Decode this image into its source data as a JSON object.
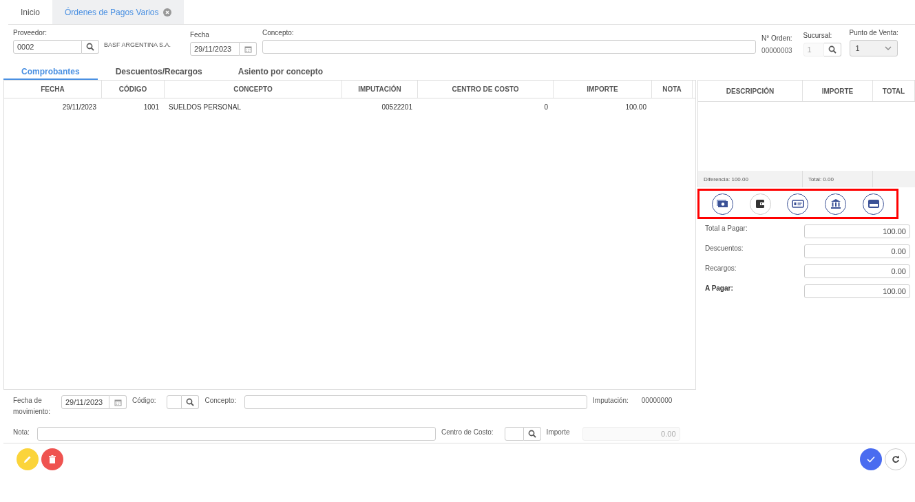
{
  "top_tabs": [
    {
      "label": "Inicio",
      "selected": false,
      "closable": false
    },
    {
      "label": "Órdenes de Pagos Varios",
      "selected": true,
      "closable": true
    }
  ],
  "header": {
    "proveedor": {
      "label": "Proveedor:",
      "value": "0002",
      "name": "BASF ARGENTINA S.A."
    },
    "fecha": {
      "label": "Fecha",
      "value": "29/11/2023"
    },
    "concepto": {
      "label": "Concepto:"
    },
    "orden": {
      "label": "N° Orden:",
      "value": "00000003"
    },
    "sucursal": {
      "label": "Sucursal:",
      "value": "1",
      "disabled": true
    },
    "punto_venta": {
      "label": "Punto de Venta:",
      "value": "1"
    }
  },
  "section_tabs": [
    {
      "label": "Comprobantes",
      "selected": true
    },
    {
      "label": "Descuentos/Recargos",
      "selected": false
    },
    {
      "label": "Asiento por concepto",
      "selected": false
    }
  ],
  "table": {
    "columns": [
      "FECHA",
      "CÓDIGO",
      "CONCEPTO",
      "IMPUTACIÓN",
      "CENTRO DE COSTO",
      "IMPORTE",
      "NOTA"
    ],
    "rows": [
      [
        "29/11/2023",
        "1001",
        "SUELDOS PERSONAL",
        "00522201",
        "0",
        "100.00",
        null
      ]
    ]
  },
  "payments": {
    "columns": [
      "DESCRIPCIÓN",
      "IMPORTE",
      "TOTAL"
    ],
    "diferencia": "Diferencia: 100.00",
    "total": "Total: 0.00"
  },
  "payment_methods": [
    {
      "kind": "cash"
    },
    {
      "kind": "wallet"
    },
    {
      "kind": "check"
    },
    {
      "kind": "bank"
    },
    {
      "kind": "card"
    }
  ],
  "totals": [
    {
      "label": "Total a Pagar:",
      "value": "100.00",
      "bold": false
    },
    {
      "label": "Descuentos:",
      "value": "0.00",
      "bold": false
    },
    {
      "label": "Recargos:",
      "value": "0.00",
      "bold": false
    },
    {
      "label": "A Pagar:",
      "value": "100.00",
      "bold": true
    }
  ],
  "movement": {
    "fecha_label": "Fecha de movimiento:",
    "fecha": "29/11/2023",
    "codigo_label": "Código:",
    "concepto_label": "Concepto:",
    "imputacion_label": "Imputación:",
    "imputacion": "00000000",
    "nota_label": "Nota:",
    "centro_label": "Centro de Costo:",
    "importe_label": "Importe",
    "importe": "0.00",
    "importe_disabled": true
  },
  "footer_buttons": [
    {
      "kind": "edit"
    },
    {
      "kind": "delete"
    },
    {
      "kind": "confirm"
    },
    {
      "kind": "refresh"
    }
  ]
}
